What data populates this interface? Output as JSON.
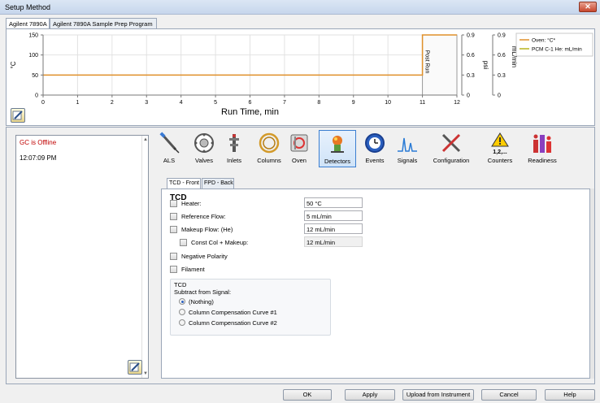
{
  "window": {
    "title": "Setup Method",
    "close_label": "✕"
  },
  "tabs": [
    {
      "label": "Agilent 7890A",
      "active": true
    },
    {
      "label": "Agilent 7890A Sample Prep Program",
      "active": false
    }
  ],
  "chart_data": {
    "type": "line",
    "xlabel": "Run Time, min",
    "x_ticks": [
      "0",
      "1",
      "2",
      "3",
      "4",
      "5",
      "6",
      "7",
      "8",
      "9",
      "10",
      "11",
      "12"
    ],
    "xlim": [
      0,
      12
    ],
    "ylabel_left": "°C",
    "y_ticks_left": [
      "150",
      "100",
      "50",
      "0"
    ],
    "ylim_left": [
      0,
      150
    ],
    "ylabel_psi": "psi",
    "y_ticks_psi": [
      "0.9",
      "0.6",
      "0.3",
      "0"
    ],
    "ylabel_flow": "mL/min",
    "y_ticks_flow": [
      "0.9",
      "0.6",
      "0.3",
      "0"
    ],
    "post_run_label": "Post Run",
    "post_run_start": 11,
    "series": [
      {
        "name": "Oven: °C*",
        "color": "#e0902a",
        "x": [
          0,
          11,
          11,
          12
        ],
        "y": [
          50,
          50,
          150,
          150
        ]
      },
      {
        "name": "PCM C-1 He: mL/min",
        "color": "#b8b21c",
        "x": [],
        "y": []
      }
    ],
    "legend": "top-right",
    "grid": true
  },
  "status": {
    "offline": "GC is Offline",
    "time": "12:07:09 PM"
  },
  "icons": [
    {
      "label": "ALS",
      "icon": "syringe-icon"
    },
    {
      "label": "Valves",
      "icon": "valve-icon"
    },
    {
      "label": "Inlets",
      "icon": "inlet-icon"
    },
    {
      "label": "Columns",
      "icon": "column-icon"
    },
    {
      "label": "Oven",
      "icon": "oven-icon"
    },
    {
      "label": "Detectors",
      "icon": "detector-icon",
      "active": true
    },
    {
      "label": "Events",
      "icon": "events-icon"
    },
    {
      "label": "Signals",
      "icon": "signals-icon"
    },
    {
      "label": "Configuration",
      "icon": "configuration-icon"
    },
    {
      "label": "Counters",
      "icon": "counters-icon",
      "badge": "1,2,..."
    },
    {
      "label": "Readiness",
      "icon": "readiness-icon"
    }
  ],
  "detector_tabs": [
    {
      "label": "TCD - Front",
      "active": true
    },
    {
      "label": "FPD - Back",
      "active": false
    }
  ],
  "tcd": {
    "title": "TCD",
    "heater_label": "Heater:",
    "heater_value": "50 °C",
    "ref_flow_label": "Reference Flow:",
    "ref_flow_value": "5 mL/min",
    "makeup_label": "Makeup Flow: (He)",
    "makeup_value": "12 mL/min",
    "const_label": "Const Col + Makeup:",
    "const_value": "12 mL/min",
    "neg_polarity_label": "Negative Polarity",
    "filament_label": "Filament",
    "group_title": "TCD",
    "subtract_label": "Subtract from Signal:",
    "options": [
      "(Nothing)",
      "Column Compensation Curve #1",
      "Column Compensation Curve #2"
    ],
    "selected_option": "(Nothing)"
  },
  "buttons": {
    "ok": "OK",
    "apply": "Apply",
    "upload": "Upload from Instrument",
    "cancel": "Cancel",
    "help": "Help"
  },
  "colors": {
    "accent": "#3c7fd1",
    "offline": "#c00000",
    "oven_line": "#e0902a",
    "pcm_line": "#b8b21c"
  }
}
